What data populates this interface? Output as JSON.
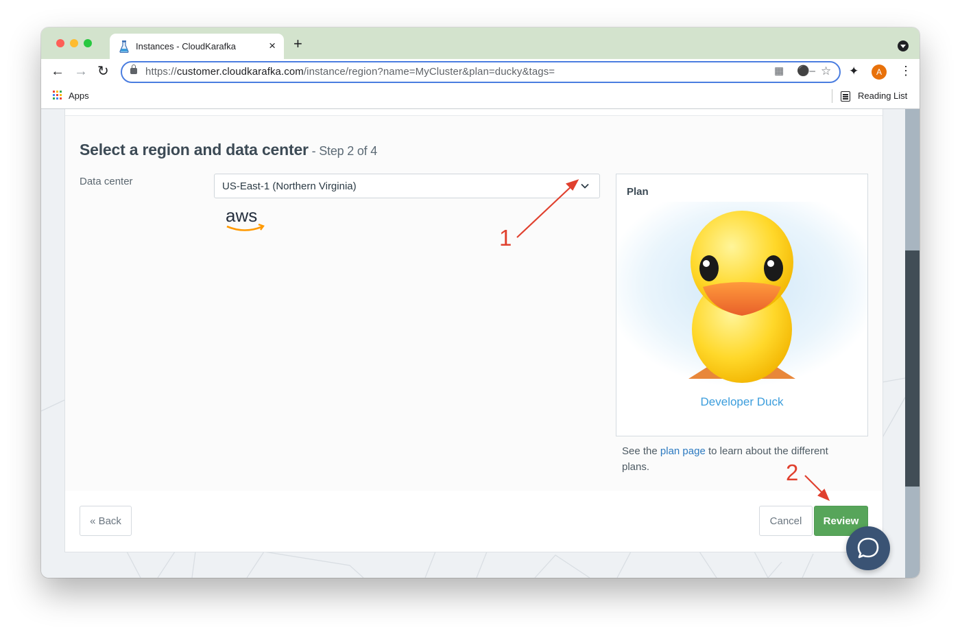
{
  "browser": {
    "tab_title": "Instances - CloudKarafka",
    "tab_close": "×",
    "new_tab": "+",
    "url_scheme": "https://",
    "url_host": "customer.cloudkarafka.com",
    "url_path": "/instance/region?name=MyCluster&plan=ducky&tags=",
    "profile_initial": "A",
    "icons": [
      "back-icon",
      "forward-icon",
      "reload-icon",
      "lock-icon",
      "qr-code-icon",
      "key-icon",
      "star-icon",
      "extensions-icon",
      "menu-icon",
      "tab-search-icon"
    ]
  },
  "bookmarks": {
    "apps_label": "Apps",
    "reading_list_label": "Reading List"
  },
  "page": {
    "heading": "Select a region and data center",
    "step": " - Step 2 of 4",
    "data_center_label": "Data center",
    "data_center_value": "US-East-1 (Northern Virginia)",
    "provider_logo_text": "aws",
    "plan": {
      "title": "Plan",
      "name": "Developer Duck"
    },
    "plan_note": {
      "before": "See the ",
      "link": "plan page",
      "after": " to learn about the different plans."
    },
    "back_label": "« Back",
    "cancel_label": "Cancel",
    "review_label": "Review"
  },
  "annotations": {
    "marker_1": "1",
    "marker_2": "2",
    "color": "#e0402e"
  },
  "colors": {
    "accent_green": "#57a55a",
    "link_blue": "#2b79c0",
    "plan_name_blue": "#3b9ddc",
    "chat_bubble": "#3a5374",
    "tabstrip": "#d3e3cd"
  }
}
